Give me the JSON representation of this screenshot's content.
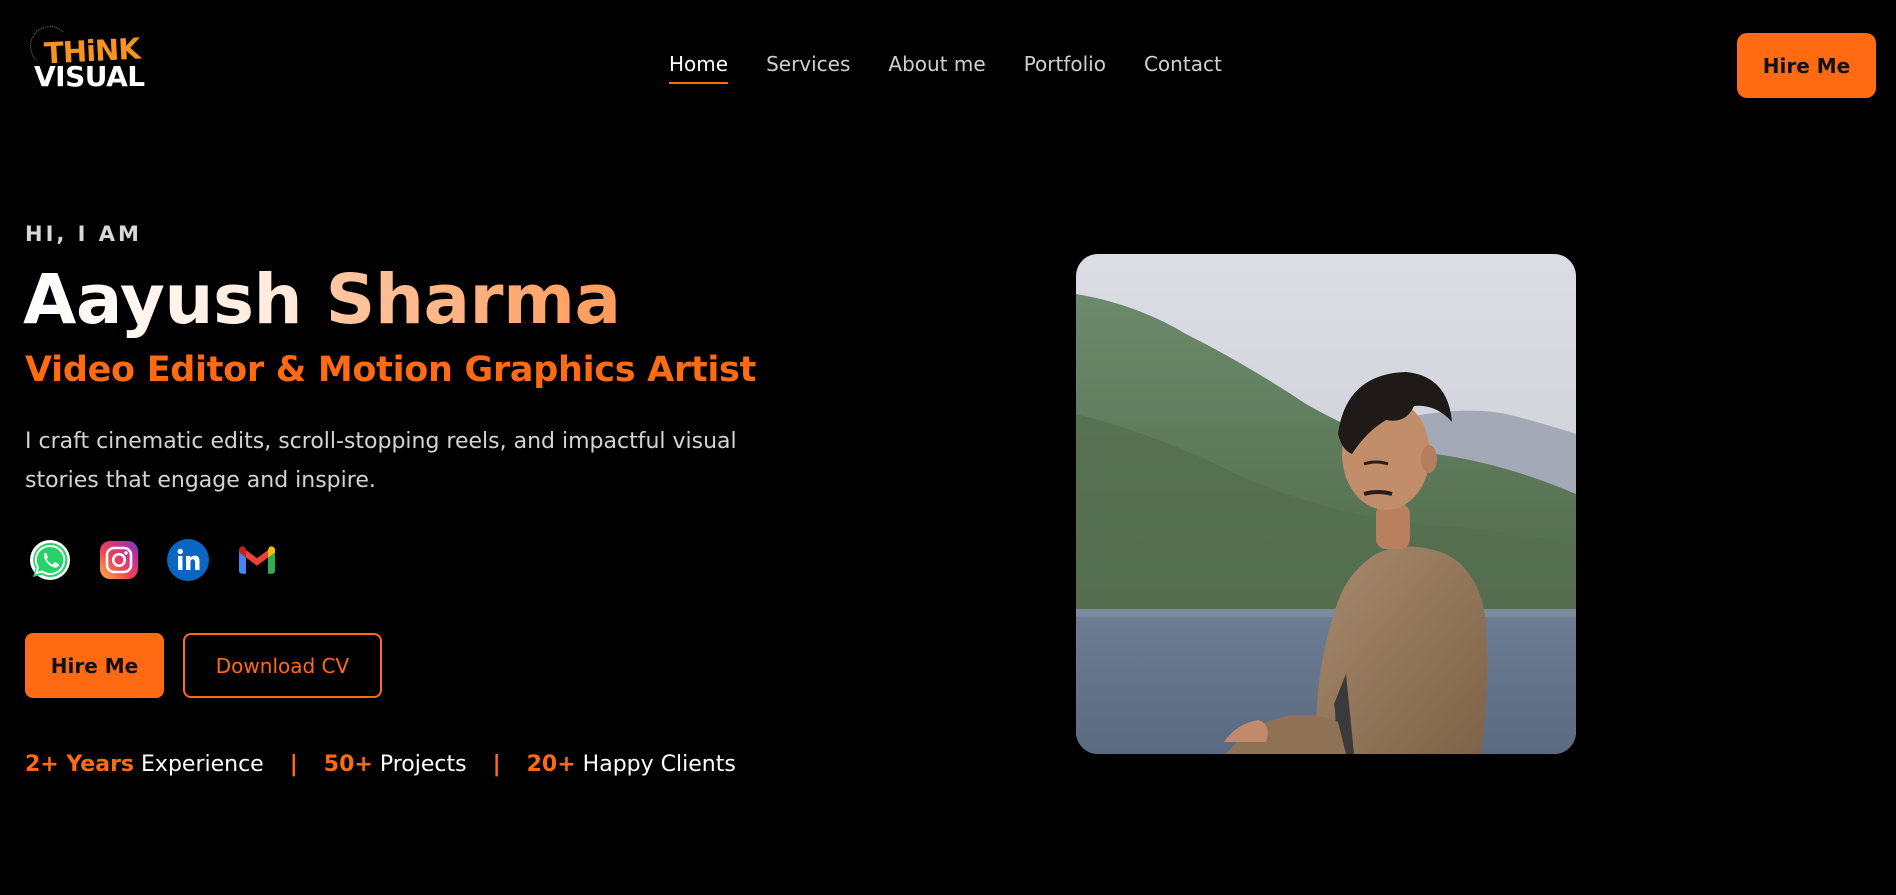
{
  "brand": {
    "logo_line1": "THiNK",
    "logo_line2": "VISUAL"
  },
  "nav": {
    "items": [
      {
        "label": "Home",
        "active": true
      },
      {
        "label": "Services",
        "active": false
      },
      {
        "label": "About me",
        "active": false
      },
      {
        "label": "Portfolio",
        "active": false
      },
      {
        "label": "Contact",
        "active": false
      }
    ]
  },
  "header": {
    "hire_label": "Hire Me"
  },
  "hero": {
    "greeting": "HI, I AM",
    "first_name": "Aayush",
    "last_name": "Sharma",
    "role": "Video Editor & Motion Graphics Artist",
    "description": "I craft cinematic edits, scroll-stopping reels, and impactful visual stories that engage and inspire.",
    "socials": [
      {
        "icon": "whatsapp-icon",
        "color": "#25d366"
      },
      {
        "icon": "instagram-icon",
        "color": "#e1306c"
      },
      {
        "icon": "linkedin-icon",
        "color": "#0a66c2"
      },
      {
        "icon": "gmail-icon",
        "color": "#ea4335"
      }
    ],
    "hire_label": "Hire Me",
    "cv_label": "Download CV",
    "stats": [
      {
        "value": "2+ Years",
        "label": "Experience"
      },
      {
        "value": "50+",
        "label": "Projects"
      },
      {
        "value": "20+",
        "label": "Happy Clients"
      }
    ],
    "separator": "|"
  },
  "colors": {
    "accent": "#ff6a13",
    "background": "#000000"
  }
}
